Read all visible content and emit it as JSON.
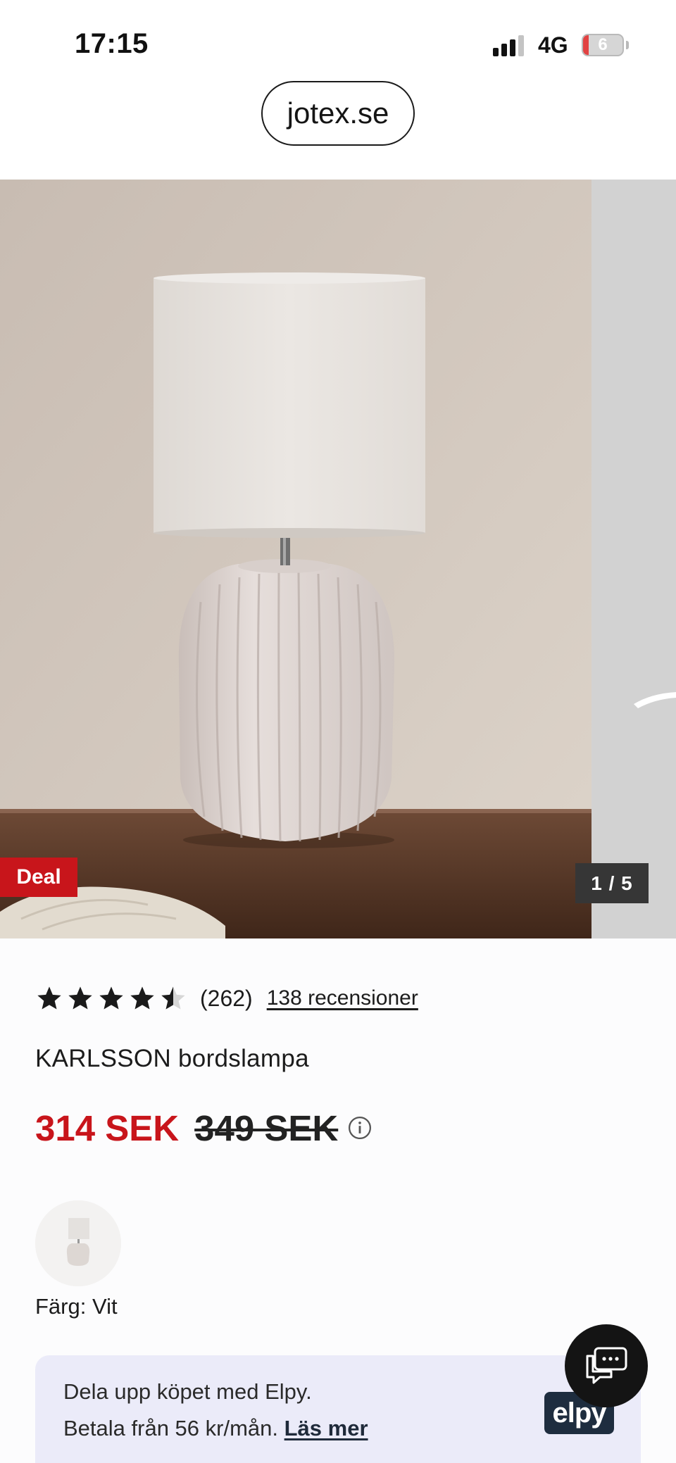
{
  "status_bar": {
    "time": "17:15",
    "network": "4G",
    "battery": "6",
    "battery_level": 0.06
  },
  "browser": {
    "url": "jotex.se"
  },
  "gallery": {
    "badge": "Deal",
    "counter": "1 / 5"
  },
  "product": {
    "rating": 4.5,
    "rating_count": "(262)",
    "reviews_link": "138 recensioner",
    "title": "KARLSSON bordslampa",
    "price_current": "314 SEK",
    "price_old": "349 SEK",
    "color_label": "Färg: Vit"
  },
  "elpy": {
    "line1": "Dela upp köpet med Elpy.",
    "line2_prefix": "Betala från 56 kr/mån.",
    "link": "Läs mer",
    "logo": "elpy"
  },
  "colors": {
    "accent_red": "#c8151b",
    "elpy_bg": "#ebebf9",
    "elpy_logo": "#1e2d3f"
  },
  "icons": {
    "rating": "star-icon",
    "price_info": "info-circle-icon",
    "chat": "chat-bubble-icon",
    "signal": "cellular-signal-icon",
    "battery": "battery-icon"
  }
}
